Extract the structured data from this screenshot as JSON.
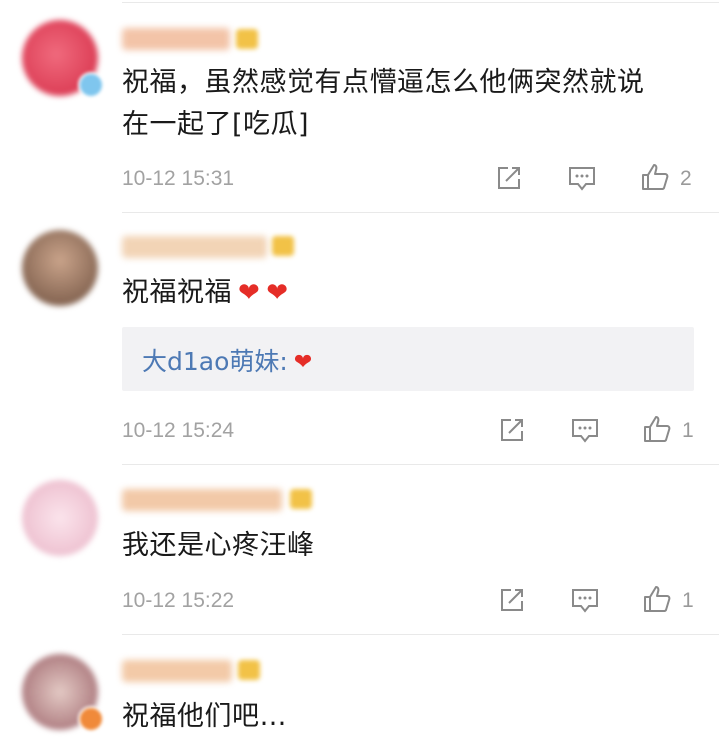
{
  "comments": [
    {
      "text_lines": [
        "祝福，虽然感觉有点懵逼怎么他俩突然就说",
        "在一起了[吃瓜]"
      ],
      "time": "10-12 15:31",
      "likes": "2",
      "avatar_color": "#e33d57"
    },
    {
      "text": "祝福祝福",
      "hearts": [
        "❤",
        "❤"
      ],
      "reply": {
        "name": "大d1ao萌妹:",
        "emoji": "❤"
      },
      "time": "10-12 15:24",
      "likes": "1",
      "avatar_color": "#8a6a55"
    },
    {
      "text": "我还是心疼汪峰",
      "time": "10-12 15:22",
      "likes": "1",
      "avatar_color": "#f0c6d4"
    },
    {
      "text": "祝福他们吧…",
      "avatar_color": "#c9a3a8"
    }
  ],
  "colors": {
    "reply_name": "#4d79b4",
    "heart": "#e52d27",
    "timestamp": "#a2a2a2",
    "username_blur": "#f0b99a",
    "badge": "#f2c247"
  },
  "icons": [
    "share-icon",
    "comment-icon",
    "like-icon",
    "verified-badge-icon"
  ]
}
